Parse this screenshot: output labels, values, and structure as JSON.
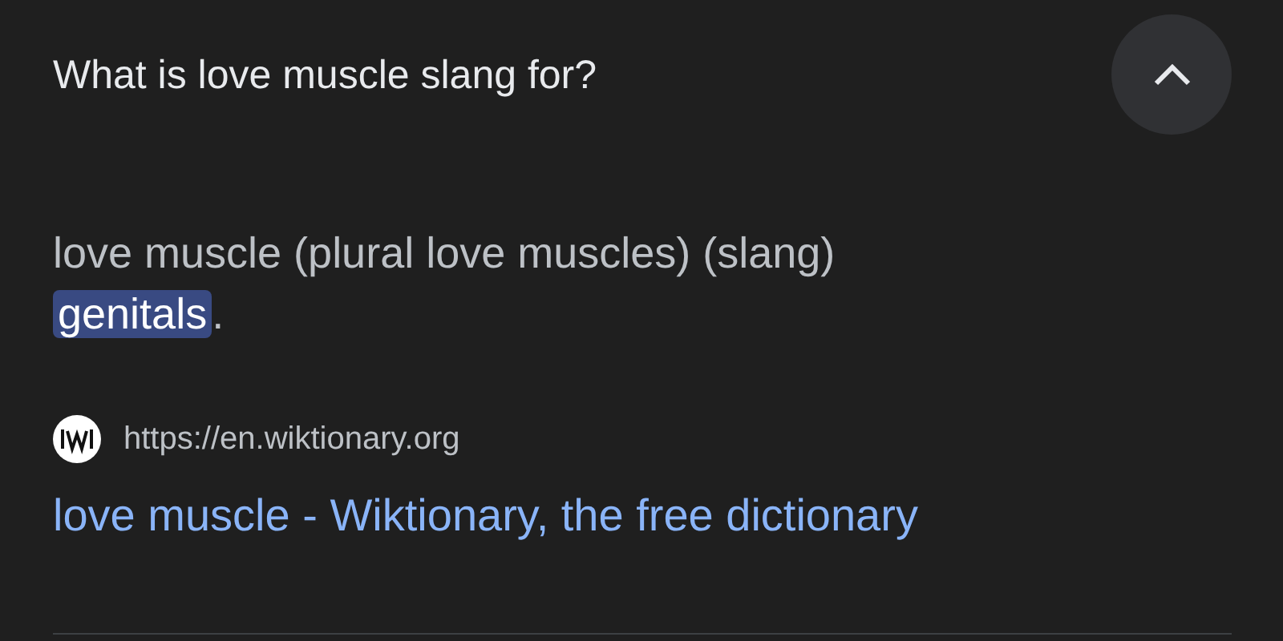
{
  "question": "What is love muscle slang for?",
  "expanded": true,
  "definition": {
    "headword_line": "love muscle (plural love muscles) (slang)",
    "highlighted": "genitals",
    "after": "."
  },
  "source": {
    "url": "https://en.wiktionary.org",
    "title": "love muscle - Wiktionary, the free dictionary"
  }
}
